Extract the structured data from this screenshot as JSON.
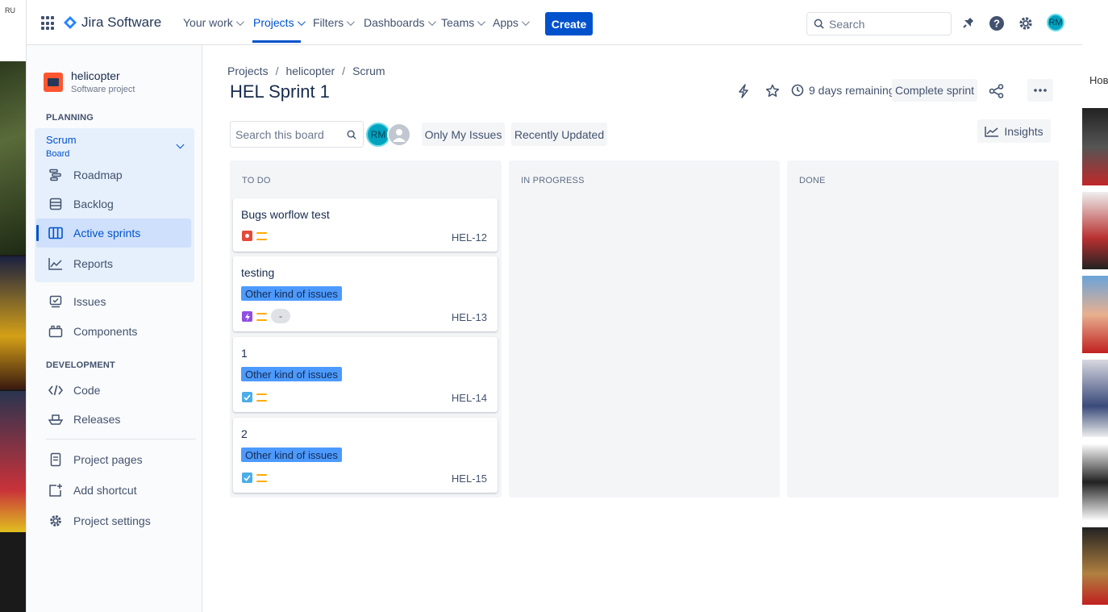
{
  "browser": {
    "lang_badge": "RU",
    "right_tab_label": "Нов"
  },
  "topnav": {
    "product_name": "Jira Software",
    "items": [
      {
        "label": "Your work"
      },
      {
        "label": "Projects"
      },
      {
        "label": "Filters"
      },
      {
        "label": "Dashboards"
      },
      {
        "label": "Teams"
      },
      {
        "label": "Apps"
      }
    ],
    "create_label": "Create",
    "search_placeholder": "Search",
    "avatar_initials": "RM"
  },
  "sidebar": {
    "project_name": "helicopter",
    "project_type": "Software project",
    "planning_heading": "PLANNING",
    "board_name": "Scrum",
    "board_sub": "Board",
    "planning_items": [
      {
        "label": "Roadmap",
        "icon": "roadmap-icon"
      },
      {
        "label": "Backlog",
        "icon": "backlog-icon"
      },
      {
        "label": "Active sprints",
        "icon": "board-columns-icon"
      },
      {
        "label": "Reports",
        "icon": "reports-chart-icon"
      }
    ],
    "other_items": [
      {
        "label": "Issues",
        "icon": "issues-icon"
      },
      {
        "label": "Components",
        "icon": "components-icon"
      }
    ],
    "development_heading": "DEVELOPMENT",
    "dev_items": [
      {
        "label": "Code",
        "icon": "code-icon"
      },
      {
        "label": "Releases",
        "icon": "releases-ship-icon"
      }
    ],
    "footer_items": [
      {
        "label": "Project pages",
        "icon": "project-pages-icon"
      },
      {
        "label": "Add shortcut",
        "icon": "add-shortcut-icon"
      },
      {
        "label": "Project settings",
        "icon": "gear-icon"
      }
    ]
  },
  "main": {
    "breadcrumbs": [
      "Projects",
      "helicopter",
      "Scrum"
    ],
    "title": "HEL Sprint 1",
    "remaining": "9 days remaining",
    "complete_sprint_label": "Complete sprint",
    "board_search_placeholder": "Search this board",
    "avatar_initials": "RM",
    "quick_filters": [
      "Only My Issues",
      "Recently Updated"
    ],
    "insights_label": "Insights",
    "columns": [
      {
        "title": "TO DO",
        "cards": [
          {
            "title": "Bugs worflow test",
            "key": "HEL-12",
            "type": "bug",
            "label": ""
          },
          {
            "title": "testing",
            "key": "HEL-13",
            "type": "epic",
            "label": "Other kind of issues",
            "pill": "-"
          },
          {
            "title": "1",
            "key": "HEL-14",
            "type": "task",
            "label": "Other kind of issues"
          },
          {
            "title": "2",
            "key": "HEL-15",
            "type": "task",
            "label": "Other kind of issues"
          }
        ]
      },
      {
        "title": "IN PROGRESS",
        "cards": []
      },
      {
        "title": "DONE",
        "cards": []
      }
    ],
    "colors": {
      "accent": "#0052cc",
      "label": "#4c9aff",
      "bug": "#e5493a",
      "epic": "#904ee2",
      "task": "#4bade8",
      "priority": "#ffab00"
    }
  }
}
